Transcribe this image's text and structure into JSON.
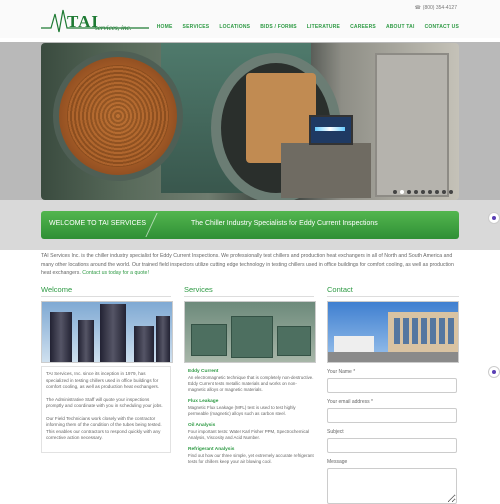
{
  "header": {
    "logo_text": "TAI",
    "logo_sub": "services, inc.",
    "phone_icon": "phone-icon",
    "phone": "(800) 354-4127",
    "nav": [
      "HOME",
      "SERVICES",
      "LOCATIONS",
      "BIDS / FORMS",
      "LITERATURE",
      "CAREERS",
      "ABOUT TAI",
      "CONTACT US"
    ]
  },
  "welcome": {
    "left": "WELCOME TO TAI SERVICES",
    "right": "The Chiller Industry Specialists for Eddy Current Inspections"
  },
  "intro": {
    "text": "TAI Services Inc. is the chiller industry specialist for Eddy Current Inspections. We professionally test chillers and production heat exchangers in all of North and South America and many other locations around the world. Our trained field inspectors utilize cutting edge technology in testing chillers used in office buildings for comfort cooling, as well as production heat exchangers.",
    "link": "Contact us today for a quote!"
  },
  "welcome_col": {
    "title": "Welcome",
    "p1": "TAI Services, Inc. since its inception in 1979, has specialized in testing chillers used in office buildings for comfort cooling, as well as production heat exchangers.",
    "p2": "The Administrative Staff will quote your inspections promptly and coordinate with you in scheduling your jobs.",
    "p3": "Our Field Technicians work closely with the contractor informing them of the condition of the tubes being tested. This enables our contractors to respond quickly with any corrective action necessary."
  },
  "services_col": {
    "title": "Services",
    "items": [
      {
        "name": "Eddy Current",
        "desc": "An electromagnetic technique that is completely non-destructive. Eddy Current tests metallic materials and works on non-magnetic alloys or magnetic materials."
      },
      {
        "name": "Flux Leakage",
        "desc": "Magnetic Flux Leakage (MFL) test is used to test highly permeable (magnetic) alloys such as carbon steel."
      },
      {
        "name": "Oil Analysis",
        "desc": "Four important tests: Water Karl Fisher PPM, Spectrochemical Analysis, Viscosity and Acid Number."
      },
      {
        "name": "Refrigerant Analysis",
        "desc": "Find out how our three simple, yet extremely accurate refrigerant tests for chillers keep your air blowing cool."
      }
    ]
  },
  "contact_col": {
    "title": "Contact",
    "fields": [
      "Your Name *",
      "Your email address *",
      "Subject",
      "Message"
    ]
  }
}
